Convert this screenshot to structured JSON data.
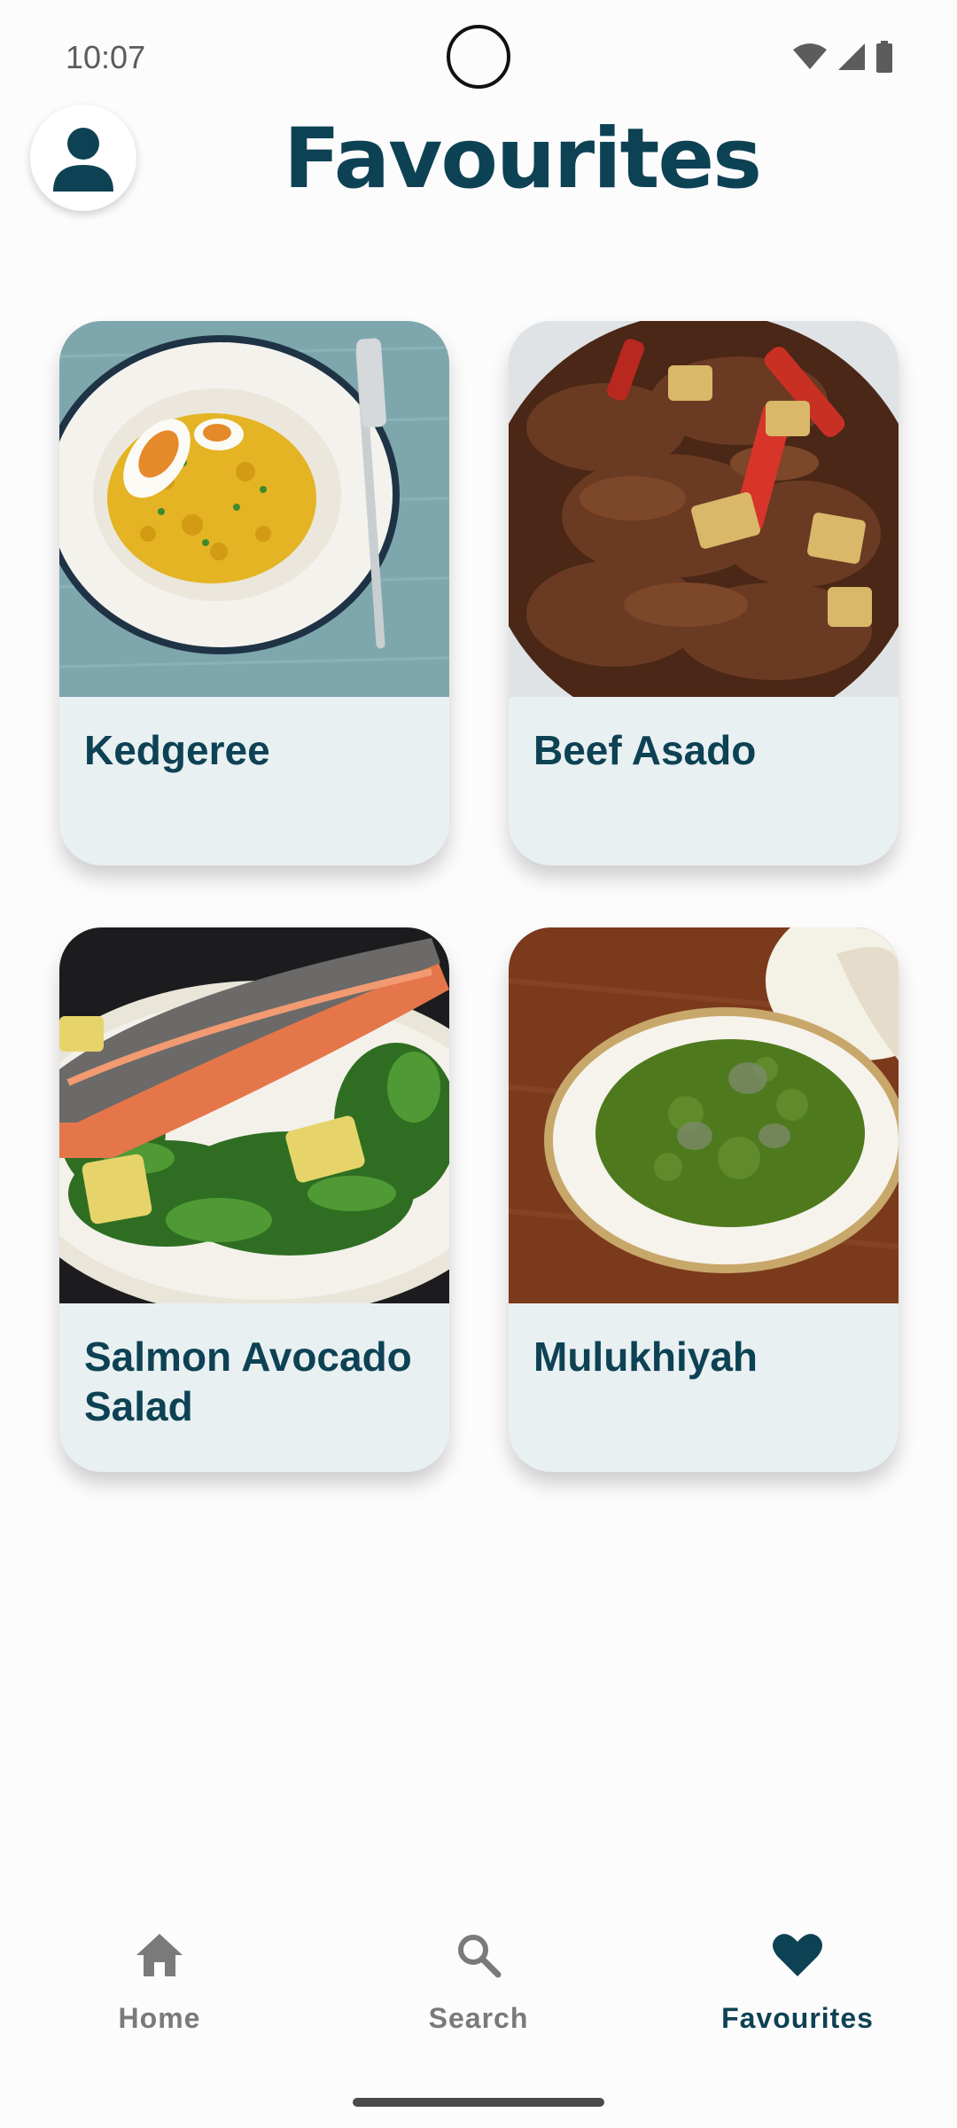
{
  "status_bar": {
    "time": "10:07",
    "icons": [
      "wifi-icon",
      "cell-signal-icon",
      "battery-icon"
    ]
  },
  "header": {
    "title": "Favourites",
    "profile_icon": "person-icon"
  },
  "favourites": [
    {
      "name": "Kedgeree"
    },
    {
      "name": "Beef Asado"
    },
    {
      "name": "Salmon Avocado Salad"
    },
    {
      "name": "Mulukhiyah"
    }
  ],
  "bottom_nav": {
    "items": [
      {
        "label": "Home",
        "icon": "home-icon",
        "active": false
      },
      {
        "label": "Search",
        "icon": "search-icon",
        "active": false
      },
      {
        "label": "Favourites",
        "icon": "heart-icon",
        "active": true
      }
    ]
  },
  "colors": {
    "primary": "#0d4254",
    "card_background": "#e9f0f2",
    "inactive_nav": "#7a7a7a"
  }
}
